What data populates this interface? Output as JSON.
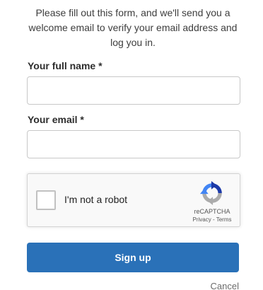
{
  "form": {
    "intro": "Please fill out this form, and we'll send you a welcome email to verify your email address and log you in.",
    "name_field": {
      "label": "Your full name *",
      "value": "",
      "placeholder": ""
    },
    "email_field": {
      "label": "Your email *",
      "value": "",
      "placeholder": ""
    },
    "captcha": {
      "checkbox_label": "I'm not a robot",
      "checked": false,
      "brand": "reCAPTCHA",
      "privacy_link": "Privacy",
      "separator": " - ",
      "terms_link": "Terms",
      "icon": "recaptcha-logo-icon"
    },
    "submit_label": "Sign up",
    "cancel_label": "Cancel"
  },
  "colors": {
    "primary_button": "#2a71b8",
    "input_border": "#c8c8c8",
    "captcha_bg": "#f9f9f9",
    "recaptcha_blue": "#1c3aa9",
    "recaptcha_light_blue": "#4285f4",
    "recaptcha_gray": "#ababab"
  }
}
